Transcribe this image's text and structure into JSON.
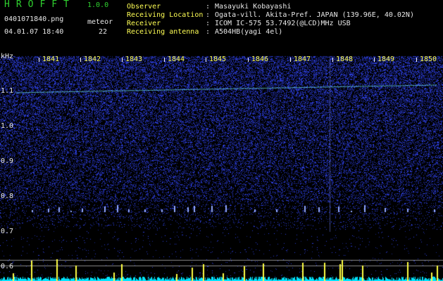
{
  "app": {
    "title": "HROFFT",
    "version": "1.0.0"
  },
  "capture": {
    "filename": "0401071840.png",
    "datetime": "04.01.07 18:40",
    "meteor_label": "meteor",
    "meteor_count": "22"
  },
  "info": [
    {
      "label": "Observer",
      "value": "Masayuki Kobayashi"
    },
    {
      "label": "Receiving Location",
      "value": "Ogata-vill. Akita-Pref. JAPAN (139.96E, 40.02N)"
    },
    {
      "label": "Receiver",
      "value": "ICOM IC-575 53.7492(@LCD)MHz USB"
    },
    {
      "label": "Receiving antenna",
      "value": "A504HB(yagi 4el)"
    }
  ],
  "spectrogram": {
    "freq_unit": "kHz",
    "y_ticks": [
      "1.1",
      "1.0",
      "0.9",
      "0.8",
      "0.7",
      "0.6"
    ],
    "x_ticks": [
      "1841",
      "1842",
      "1843",
      "1844",
      "1845",
      "1846",
      "1847",
      "1848",
      "1849",
      "1850"
    ],
    "colors": {
      "background": "#000000",
      "noise_blue": "#3a4cff",
      "carrier": "#6fe8f0",
      "signal_yellow": "#ffff44",
      "baseline_cyan": "#00e5ff",
      "grid": "#8a8a8a"
    }
  }
}
